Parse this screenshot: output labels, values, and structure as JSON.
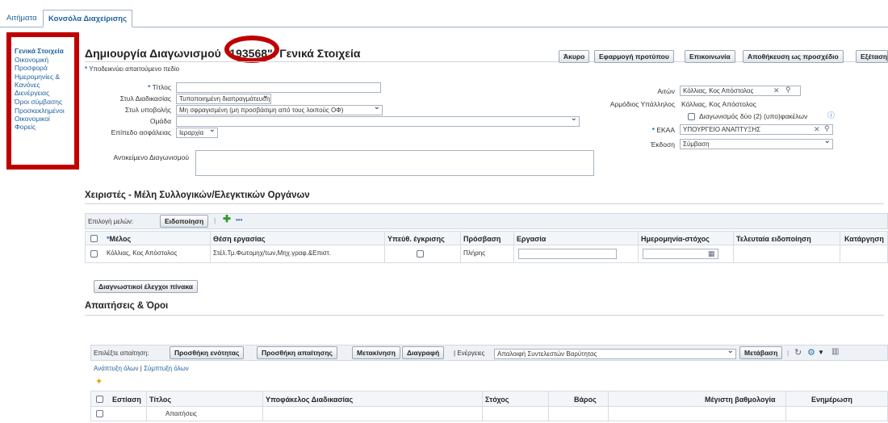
{
  "tabs": [
    {
      "label": "Αιτήματα"
    },
    {
      "label": "Κονσόλα Διαχείρισης"
    }
  ],
  "nav": [
    "Γενικά Στοιχεία",
    "Οικονομική Προσφορά",
    "Ημερομηνίες & Κανόνες Διενέργειας",
    "Όροι σύμβασης",
    "Προσκεκλημένοι Οικονομικοί Φορείς"
  ],
  "header": {
    "title": "Δημιουργία Διαγωνισμού \"193568\": Γενικά Στοιχεία",
    "buttons": [
      "Άκυρο",
      "Εφαρμογή προτύπου",
      "Επικοινωνία",
      "Αποθήκευση ως προσχέδιο",
      "Εξέταση"
    ]
  },
  "form": {
    "required_note": "Υποδεικνύει απαιτούμενο πεδίο",
    "labels": {
      "title": "Τίτλος",
      "process_style": "Στυλ Διαδικασίας",
      "submission_style": "Στυλ υποβολής",
      "group": "Ομάδα",
      "security_level": "Επίπεδο ασφάλειας",
      "subject": "Αντικείμενο Διαγωνισμού",
      "requester": "Αιτών",
      "officer": "Αρμόδιος Υπάλληλος",
      "ekaa": "ΕΚΑΑ",
      "version": "Έκδοση"
    },
    "values": {
      "title": "",
      "process_style": "Τυποποιημένη διαπραγμάτευση",
      "submission_style": "Μη σφραγισμένη (μη προσβάσιμη από τους λοιπούς ΟΦ)",
      "group": "",
      "security_level": "Ιεραρχία",
      "requester": "Κόλλιας, Κος Απόστολος",
      "officer": "Κόλλιας, Κος Απόστολος",
      "two_envelope": "Διαγωνισμός δύο (2) (υπο)φακέλων",
      "ekaa": "ΥΠΟΥΡΓΕΙΟ ΑΝΑΠΤΥΞΗΣ",
      "version": "Σύμβαση"
    }
  },
  "committee": {
    "heading": "Χειριστές - Μέλη Συλλογικών/Ελεγκτικών Οργάνων",
    "select_label": "Επιλογή μελών:",
    "notify_button": "Ειδοποίηση",
    "more": "•••",
    "columns": [
      "Μέλος",
      "Θέση εργασίας",
      "Υπεύθ. έγκρισης",
      "Πρόσβαση",
      "Εργασία",
      "Ημερομηνία-στόχος",
      "Τελευταία ειδοποίηση",
      "Κατάργηση"
    ],
    "rows": [
      {
        "member": "Κόλλιας, Κος Απόστολος",
        "position": "Στέλ.Τμ.Φωτομηχ/των,Μηχ.γραφ.&Επιστ.",
        "access": "Πλήρης",
        "task": "",
        "target_date": "",
        "last_notice": ""
      }
    ],
    "diagnostics_button": "Διαγνωστικοί έλεγχοι πίνακα"
  },
  "requirements": {
    "heading": "Απαιτήσεις & Όροι",
    "select_label": "Επιλέξτε απαίτηση:",
    "buttons": [
      "Προσθήκη ενότητας",
      "Προσθήκη απαίτησης",
      "Μετακίνηση",
      "Διαγραφή"
    ],
    "actions_label": "Ενέργειες",
    "action_value": "Απαλοιφή Συντελεστών Βαρύτητας",
    "go_button": "Μετάβαση",
    "expand_all": "Ανάπτυξη όλων",
    "collapse_all": "Σύμπτυξη όλων",
    "columns": [
      "Εστίαση",
      "Τίτλος",
      "Υποφάκελος Διαδικασίας",
      "Στόχος",
      "Βάρος",
      "Μέγιστη βαθμολογία",
      "Ενημέρωση"
    ],
    "rows": [
      {
        "title": "Απαιτήσεις"
      }
    ]
  },
  "icons": {
    "search": "search-icon",
    "clear": "clear-icon",
    "info": "info-icon",
    "calendar": "calendar-icon",
    "add": "add-icon",
    "refresh": "refresh-icon",
    "settings": "gear-icon",
    "columns": "columns-icon"
  },
  "colors": {
    "link": "#1f5f9e",
    "highlight": "#c00000",
    "required": "#2a6fc0"
  }
}
